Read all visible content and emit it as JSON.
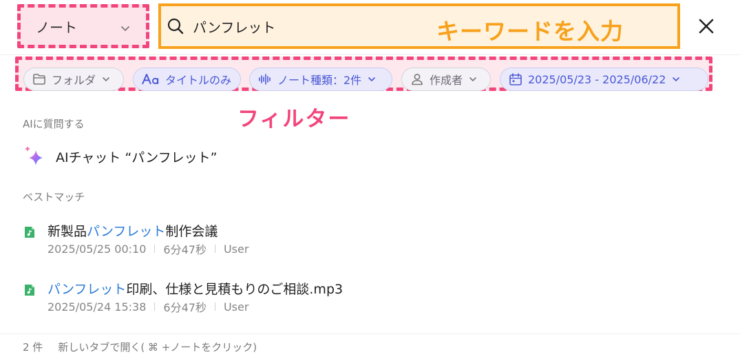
{
  "search": {
    "scope_label": "ノート",
    "query": "パンフレット",
    "annotation": "キーワードを入力"
  },
  "filters": {
    "annotation": "フィルター",
    "chips": [
      {
        "label": "フォルダ",
        "icon": "folder-icon",
        "active": false
      },
      {
        "label": "タイトルのみ",
        "icon": "text-icon",
        "active": true
      },
      {
        "label": "ノート種類：2件",
        "icon": "waveform-icon",
        "active": true
      },
      {
        "label": "作成者",
        "icon": "person-icon",
        "active": false
      },
      {
        "label": "2025/05/23 - 2025/06/22",
        "icon": "calendar-icon",
        "active": true
      }
    ]
  },
  "ask_ai": {
    "section_title": "AIに質問する",
    "item_label": "AIチャット “パンフレット”"
  },
  "best_match": {
    "section_title": "ベストマッチ",
    "results": [
      {
        "title_pre": "新製品",
        "title_highlight": "パンフレット",
        "title_post": "制作会議",
        "date": "2025/05/25 00:10",
        "duration": "6分47秒",
        "author": "User"
      },
      {
        "title_pre": "",
        "title_highlight": "パンフレット",
        "title_post": "印刷、仕様と見積もりのご相談.mp3",
        "date": "2025/05/24 15:38",
        "duration": "6分47秒",
        "author": "User"
      }
    ]
  },
  "footer": {
    "count": "2 件",
    "hint": "新しいタブで開く( ⌘ +ノートをクリック)"
  },
  "colors": {
    "accent_blue": "#4a57d6",
    "highlight_blue": "#2a7bd9",
    "annotation_pink": "#f2457b",
    "annotation_orange": "#f7a11c",
    "file_green": "#3bb26b"
  }
}
